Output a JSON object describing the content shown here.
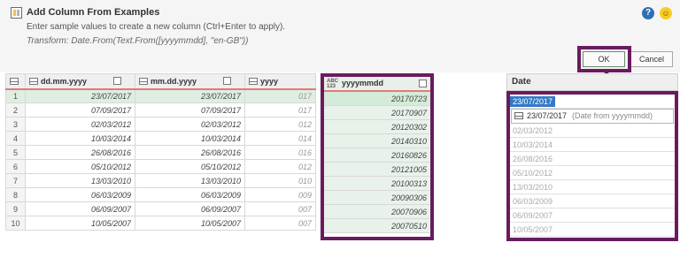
{
  "dialog": {
    "title": "Add Column From Examples",
    "description": "Enter sample values to create a new column (Ctrl+Enter to apply).",
    "formula": "Transform: Date.From(Text.From([yyyymmdd], \"en-GB\"))",
    "help_icon": "?",
    "smile_icon": "☺",
    "ok_label": "OK",
    "cancel_label": "Cancel"
  },
  "grid": {
    "columns": [
      "dd.mm.yyyy",
      "mm.dd.yyyy",
      "yyyy"
    ],
    "rows": [
      {
        "n": "1",
        "a": "23/07/2017",
        "b": "23/07/2017"
      },
      {
        "n": "2",
        "a": "07/09/2017",
        "b": "07/09/2017"
      },
      {
        "n": "3",
        "a": "02/03/2012",
        "b": "02/03/2012"
      },
      {
        "n": "4",
        "a": "10/03/2014",
        "b": "10/03/2014"
      },
      {
        "n": "5",
        "a": "26/08/2016",
        "b": "26/08/2016"
      },
      {
        "n": "6",
        "a": "05/10/2012",
        "b": "05/10/2012"
      },
      {
        "n": "7",
        "a": "13/03/2010",
        "b": "13/03/2010"
      },
      {
        "n": "8",
        "a": "06/03/2009",
        "b": "06/03/2009"
      },
      {
        "n": "9",
        "a": "06/09/2007",
        "b": "06/09/2007"
      },
      {
        "n": "10",
        "a": "10/05/2007",
        "b": "10/05/2007"
      }
    ],
    "partial_values": [
      "017",
      "017",
      "012",
      "014",
      "016",
      "012",
      "010",
      "009",
      "007",
      "007"
    ]
  },
  "ymd": {
    "type_icon_top": "ABC",
    "type_icon_bottom": "123",
    "header": "yyyymmdd",
    "next_header": "Date",
    "values": [
      "20170723",
      "20170907",
      "20120302",
      "20140310",
      "20160826",
      "20121005",
      "20100313",
      "20090306",
      "20070906",
      "20070510"
    ]
  },
  "date_column": {
    "header": "Date",
    "edit_value": "23/07/2017",
    "suggestion_value": "23/07/2017",
    "suggestion_hint": "(Date from yyyymmdd)",
    "values": [
      "02/03/2012",
      "10/03/2014",
      "26/08/2016",
      "05/10/2012",
      "13/03/2010",
      "06/03/2009",
      "06/09/2007",
      "10/05/2007"
    ]
  },
  "colors": {
    "highlight": "#6a1b5e",
    "row_green": "#dfeee1",
    "selection_blue": "#3478c6"
  }
}
